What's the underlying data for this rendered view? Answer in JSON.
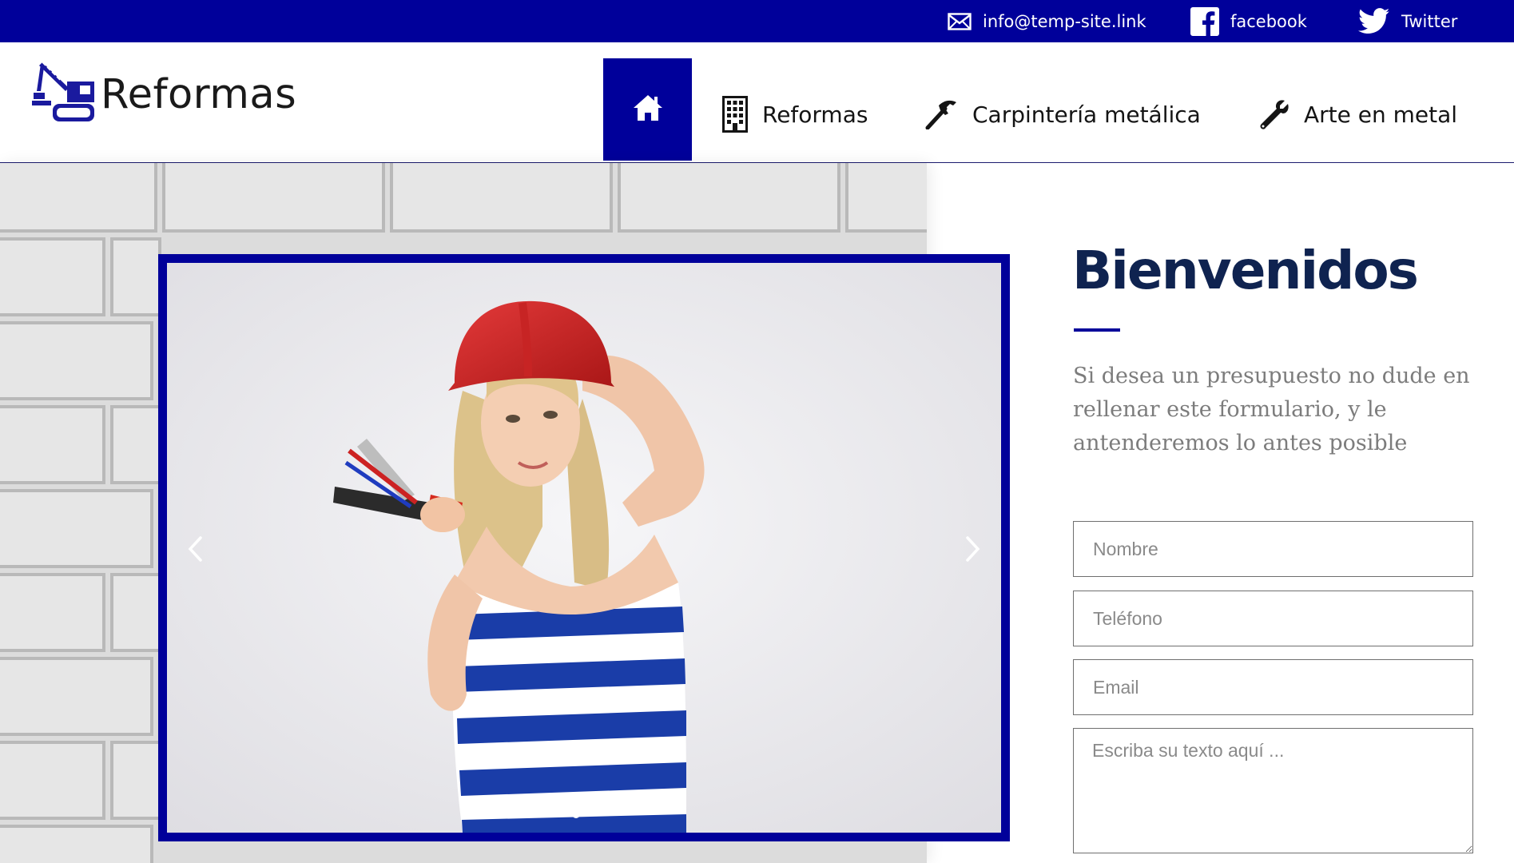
{
  "topbar": {
    "email": {
      "icon": "envelope-icon",
      "label": "info@temp-site.link"
    },
    "facebook": {
      "icon": "facebook-icon",
      "label": "facebook"
    },
    "twitter": {
      "icon": "twitter-icon",
      "label": "Twitter"
    }
  },
  "brand": {
    "logo_icon": "crane-icon",
    "name": "Reformas"
  },
  "nav": {
    "home": {
      "icon": "home-icon"
    },
    "items": [
      {
        "icon": "building-icon",
        "label": "Reformas"
      },
      {
        "icon": "hammer-icon",
        "label": "Carpintería metálica"
      },
      {
        "icon": "wrench-icon",
        "label": "Arte en metal"
      }
    ]
  },
  "slider": {
    "prev_icon": "chevron-left-icon",
    "next_icon": "chevron-right-icon",
    "slide_count": 1,
    "active_slide": 1
  },
  "welcome": {
    "title": "Bienvenidos",
    "intro": "Si desea un presupuesto no dude en rellenar este formulario, y le antenderemos lo antes posible"
  },
  "form": {
    "nombre_placeholder": "Nombre",
    "telefono_placeholder": "Teléfono",
    "email_placeholder": "Email",
    "message_placeholder": "Escriba su texto aquí ..."
  },
  "colors": {
    "brand_blue": "#00009a",
    "title_navy": "#0f2350",
    "intro_grey": "#7c7c7c"
  }
}
